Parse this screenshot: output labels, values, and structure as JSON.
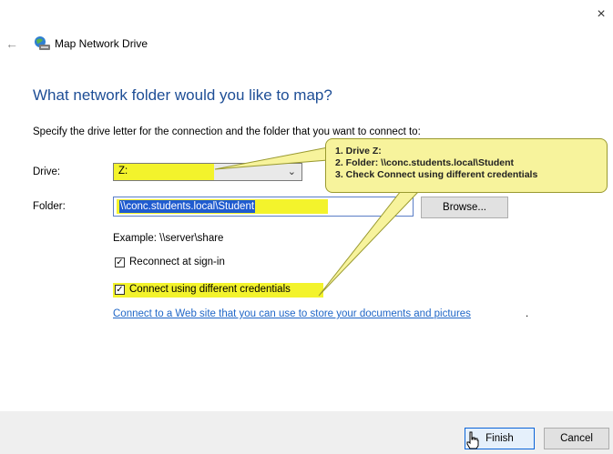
{
  "window": {
    "title": "Map Network Drive",
    "close_glyph": "×",
    "back_glyph": "←"
  },
  "main": {
    "heading": "What network folder would you like to map?",
    "instruction": "Specify the drive letter for the connection and the folder that you want to connect to:",
    "drive": {
      "label": "Drive:",
      "value": "Z:"
    },
    "folder": {
      "label": "Folder:",
      "value": "\\\\conc.students.local\\Student",
      "browse_label": "Browse..."
    },
    "example": "Example: \\\\server\\share",
    "reconnect": {
      "label": "Reconnect at sign-in",
      "checked": true
    },
    "credentials": {
      "label": "Connect using different credentials",
      "checked": true
    },
    "link": {
      "text": "Connect to a Web site that you can use to store your documents and pictures",
      "trailing": "."
    }
  },
  "footer": {
    "finish_label": "Finish",
    "cancel_label": "Cancel"
  },
  "callout": {
    "lines": [
      "1. Drive Z:",
      "2. Folder: \\\\conc.students.local\\Student",
      "3. Check Connect using different credentials"
    ]
  },
  "colors": {
    "heading": "#1e4e96",
    "highlight": "#f3f32c",
    "link": "#1f66c7",
    "callout_bg": "#f7f39c"
  },
  "icons": {
    "app": "network-drive-icon",
    "cursor": "hand-cursor-icon"
  }
}
